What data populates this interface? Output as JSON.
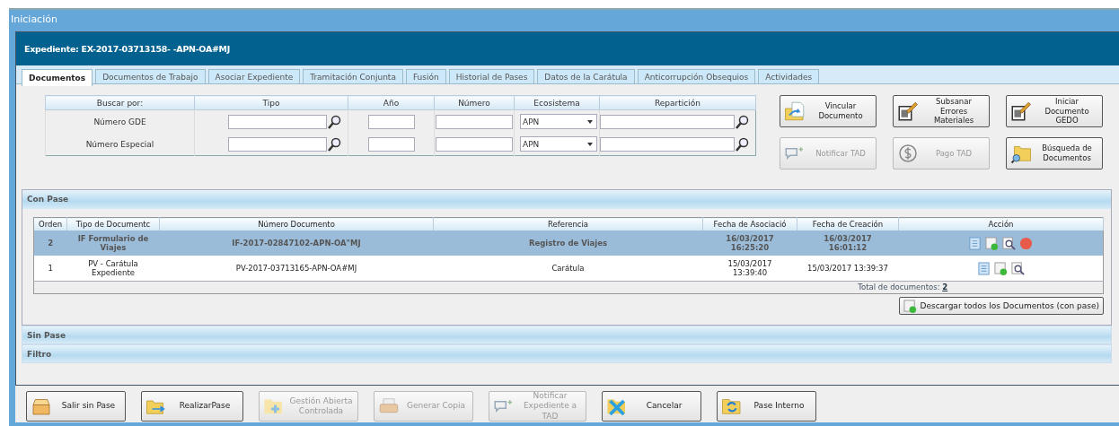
{
  "window": {
    "title": "Iniciación"
  },
  "header": {
    "title": "Expediente: EX-2017-03713158- -APN-OA#MJ"
  },
  "tabs": [
    {
      "label": "Documentos",
      "selected": true
    },
    {
      "label": "Documentos de Trabajo",
      "selected": false
    },
    {
      "label": "Asociar Expediente",
      "selected": false
    },
    {
      "label": "Tramitación Conjunta",
      "selected": false
    },
    {
      "label": "Fusión",
      "selected": false
    },
    {
      "label": "Historial de Pases",
      "selected": false
    },
    {
      "label": "Datos de la Carátula",
      "selected": false
    },
    {
      "label": "Anticorrupción Obsequios",
      "selected": false
    },
    {
      "label": "Actividades",
      "selected": false
    }
  ],
  "search": {
    "columns": [
      "Buscar por:",
      "Tipo",
      "Año",
      "Número",
      "Ecosistema",
      "Repartición"
    ],
    "rows": [
      {
        "label": "Número GDE",
        "ecosistema": "APN"
      },
      {
        "label": "Número Especial",
        "ecosistema": "APN"
      }
    ]
  },
  "side_buttons": [
    {
      "label": "Vincular\nDocumento",
      "kind": "link",
      "disabled": false
    },
    {
      "label": "Subsanar\nErrores Materiales",
      "kind": "edit",
      "disabled": false
    },
    {
      "label": "Iniciar\nDocumento GEDO",
      "kind": "edit",
      "disabled": false
    },
    {
      "label": "Notificar TAD",
      "kind": "notify",
      "disabled": true
    },
    {
      "label": "Pago TAD",
      "kind": "pay",
      "disabled": true
    },
    {
      "label": "Búsqueda de\nDocumentos",
      "kind": "search",
      "disabled": false
    }
  ],
  "con_pase": {
    "title": "Con Pase",
    "columns": [
      "Orden",
      "Tipo de Documentc",
      "Número Documento",
      "Referencia",
      "Fecha de Asociació",
      "Fecha de Creación",
      "Acción"
    ],
    "rows": [
      {
        "orden": "2",
        "tipo": "IF  Formulario de\nViajes",
        "numero": "IF-2017-02847102-APN-OA\"MJ",
        "referencia": "Registro de Viajes",
        "fecha_asociacion": "16/03/2017\n16:25:20",
        "fecha_creacion": "16/03/2017\n16:01:12",
        "selected": true,
        "actions": [
          {
            "kind": "view"
          },
          {
            "kind": "download"
          },
          {
            "kind": "preview"
          },
          {
            "kind": "delete"
          }
        ]
      },
      {
        "orden": "1",
        "tipo": "PV - Carátula\nExpediente",
        "numero": "PV-2017-03713165-APN-OA#MJ",
        "referencia": "Carátula",
        "fecha_asociacion": "15/03/2017\n13:39:40",
        "fecha_creacion": "15/03/2017 13:39:37",
        "selected": false,
        "actions": [
          {
            "kind": "view"
          },
          {
            "kind": "download"
          },
          {
            "kind": "preview"
          }
        ]
      }
    ],
    "total_label": "Total de documentos:",
    "total_value": "2",
    "download_button": "Descargar todos los Documentos (con pase)"
  },
  "sections": [
    "Sin Pase",
    "Filtro"
  ],
  "bottom_buttons": [
    {
      "label": "Salir sin Pase",
      "kind": "exit",
      "disabled": false
    },
    {
      "label": "RealizarPase",
      "kind": "send",
      "disabled": false
    },
    {
      "label": "Gestión Abierta\nControlada",
      "kind": "open",
      "disabled": true
    },
    {
      "label": "Generar Copia",
      "kind": "copy",
      "disabled": true
    },
    {
      "label": "Notificar\nExpediente a TAD",
      "kind": "notify",
      "disabled": true
    },
    {
      "label": "Cancelar",
      "kind": "cancel",
      "disabled": false
    },
    {
      "label": "Pase Interno",
      "kind": "internal",
      "disabled": false
    }
  ]
}
